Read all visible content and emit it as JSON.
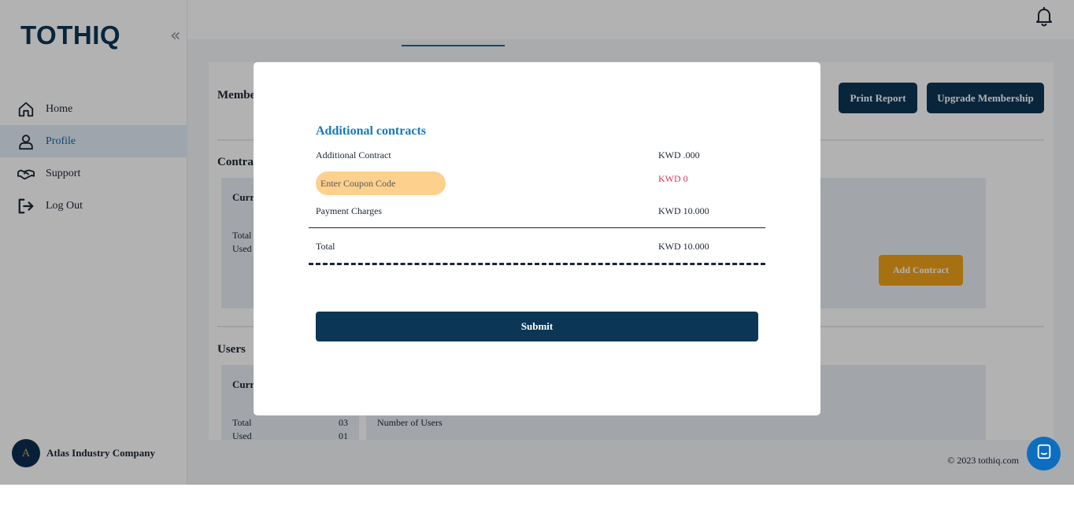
{
  "app": {
    "logo": "TOTHIQ",
    "collapse_glyph": "«",
    "nav": [
      {
        "label": "Home",
        "icon": "home-icon"
      },
      {
        "label": "Profile",
        "icon": "user-icon"
      },
      {
        "label": "Support",
        "icon": "handshake-icon"
      },
      {
        "label": "Log Out",
        "icon": "logout-icon"
      }
    ],
    "active_nav": "Profile",
    "company": {
      "name": "Atlas Industry Company",
      "avatar_text": "A"
    },
    "footer": "© 2023 tothiq.com"
  },
  "page": {
    "membership_title": "Membe",
    "print_report_label": "Print Report",
    "upgrade_label": "Upgrade Membership",
    "contracts_title": "Contra",
    "contracts_card": {
      "title": "Curr",
      "total_label": "Total",
      "used_label": "Used"
    },
    "add_contract_label": "Add Contract",
    "users_title": "Users",
    "users_card": {
      "title": "Curr",
      "total_label": "Total",
      "total_value": "03",
      "used_label": "Used",
      "used_value": "01",
      "number_of_users_label": "Number of Users"
    }
  },
  "modal": {
    "title": "Additional contracts",
    "rows": {
      "additional_contract": {
        "label": "Additional Contract",
        "value": "KWD .000"
      },
      "coupon": {
        "placeholder": "Enter Coupon Code",
        "value": "KWD 0"
      },
      "payment_charges": {
        "label": "Payment Charges",
        "value": "KWD 10.000"
      },
      "total": {
        "label": "Total",
        "value": "KWD 10.000"
      }
    },
    "submit_label": "Submit"
  },
  "colors": {
    "primary": "#0c3656",
    "accent_blue": "#1479b8",
    "coupon_bg": "#fdd08e",
    "discount_red": "#e0365e",
    "add_contract_orange": "#f0a319"
  }
}
